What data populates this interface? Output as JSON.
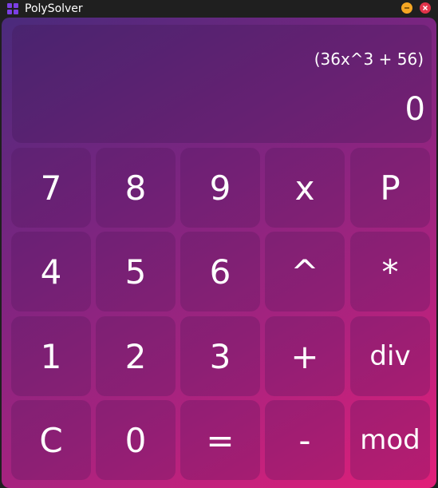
{
  "window": {
    "title": "PolySolver",
    "app_icon": "grid-app-icon"
  },
  "display": {
    "expression": "(36x^3 + 56)",
    "result": "0"
  },
  "keys": {
    "k7": "7",
    "k8": "8",
    "k9": "9",
    "kx": "x",
    "kP": "P",
    "k4": "4",
    "k5": "5",
    "k6": "6",
    "kpow": "^",
    "kmul": "*",
    "k1": "1",
    "k2": "2",
    "k3": "3",
    "kadd": "+",
    "kdiv": "div",
    "kC": "C",
    "k0": "0",
    "keq": "=",
    "ksub": "-",
    "kmod": "mod"
  },
  "colors": {
    "gradient_start": "#4a2a7c",
    "gradient_end": "#e21f79",
    "minimize": "#f5a623",
    "close": "#e0334a"
  }
}
